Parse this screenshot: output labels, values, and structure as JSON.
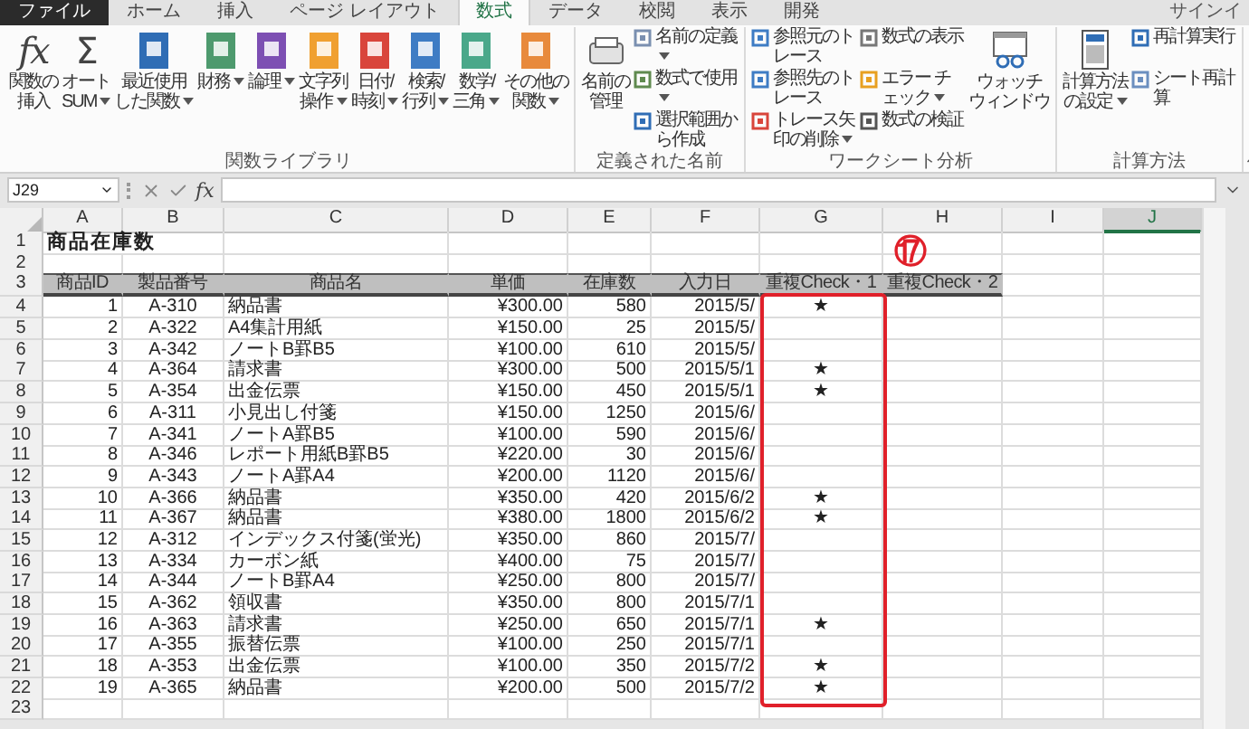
{
  "tabs": [
    {
      "label": "ファイル",
      "kind": "file",
      "selected": false
    },
    {
      "label": "ホーム",
      "kind": "tab",
      "selected": false
    },
    {
      "label": "挿入",
      "kind": "tab",
      "selected": false
    },
    {
      "label": "ページ レイアウト",
      "kind": "tab",
      "selected": false
    },
    {
      "label": "数式",
      "kind": "tab",
      "selected": true
    },
    {
      "label": "データ",
      "kind": "tab",
      "selected": false
    },
    {
      "label": "校閲",
      "kind": "tab",
      "selected": false
    },
    {
      "label": "表示",
      "kind": "tab",
      "selected": false
    },
    {
      "label": "開発",
      "kind": "tab",
      "selected": false
    }
  ],
  "account": "サインイ",
  "ribbon": {
    "groups": [
      {
        "title": "関数ライブラリ",
        "items": [
          {
            "kind": "large",
            "lines": [
              "関数の",
              "挿入"
            ],
            "glyph": "fx",
            "dropdown": false
          },
          {
            "kind": "large",
            "lines": [
              "オート",
              "SUM"
            ],
            "glyph": "Σ",
            "dropdown": true
          },
          {
            "kind": "large",
            "lines": [
              "最近使用",
              "した関数"
            ],
            "dropdown": true
          },
          {
            "kind": "large",
            "lines": [
              "財務"
            ],
            "dropdown": true
          },
          {
            "kind": "large",
            "lines": [
              "論理"
            ],
            "dropdown": true
          },
          {
            "kind": "large",
            "lines": [
              "文字列",
              "操作"
            ],
            "dropdown": true
          },
          {
            "kind": "large",
            "lines": [
              "日付/",
              "時刻"
            ],
            "dropdown": true
          },
          {
            "kind": "large",
            "lines": [
              "検索/",
              "行列"
            ],
            "dropdown": true
          },
          {
            "kind": "large",
            "lines": [
              "数学/",
              "三角"
            ],
            "dropdown": true
          },
          {
            "kind": "large",
            "lines": [
              "その他の",
              "関数"
            ],
            "dropdown": true
          }
        ]
      },
      {
        "title": "定義された名前",
        "items": [
          {
            "kind": "large",
            "lines": [
              "名前の",
              "管理"
            ],
            "dropdown": false
          },
          {
            "kind": "small",
            "label": "名前の定義",
            "dropdown": true
          },
          {
            "kind": "small",
            "label": "数式で使用",
            "dropdown": true
          },
          {
            "kind": "small",
            "label": "選択範囲から作成",
            "dropdown": false
          }
        ]
      },
      {
        "title": "ワークシート分析",
        "items": [
          {
            "kind": "small",
            "label": "参照元のトレース",
            "dropdown": false
          },
          {
            "kind": "small",
            "label": "参照先のトレース",
            "dropdown": false
          },
          {
            "kind": "small",
            "label": "トレース矢印の削除",
            "dropdown": true
          },
          {
            "kind": "small",
            "label": "数式の表示",
            "dropdown": false
          },
          {
            "kind": "small",
            "label": "エラー チェック",
            "dropdown": true
          },
          {
            "kind": "small",
            "label": "数式の検証",
            "dropdown": false
          },
          {
            "kind": "large",
            "lines": [
              "ウォッチ",
              "ウィンドウ"
            ],
            "dropdown": false
          }
        ]
      },
      {
        "title": "計算方法",
        "items": [
          {
            "kind": "large",
            "lines": [
              "計算方法",
              "の設定"
            ],
            "dropdown": true
          },
          {
            "kind": "small",
            "label": "再計算実行",
            "dropdown": false
          },
          {
            "kind": "small",
            "label": "シート再計算",
            "dropdown": false
          }
        ]
      }
    ]
  },
  "formula_bar": {
    "name_box": "J29",
    "function_button": "fx"
  },
  "sheet": {
    "columns": [
      {
        "label": "A",
        "selected": false
      },
      {
        "label": "B",
        "selected": false
      },
      {
        "label": "C",
        "selected": false
      },
      {
        "label": "D",
        "selected": false
      },
      {
        "label": "E",
        "selected": false
      },
      {
        "label": "F",
        "selected": false
      },
      {
        "label": "G",
        "selected": false
      },
      {
        "label": "H",
        "selected": false
      },
      {
        "label": "I",
        "selected": false
      },
      {
        "label": "J",
        "selected": true
      }
    ],
    "row_numbers": [
      "1",
      "2",
      "3",
      "4",
      "5",
      "6",
      "7",
      "8",
      "9",
      "10",
      "11",
      "12",
      "13",
      "14",
      "15",
      "16",
      "17",
      "18",
      "19",
      "20",
      "21",
      "22",
      "23"
    ],
    "title": "商品在庫数",
    "header": [
      "商品ID",
      "製品番号",
      "商品名",
      "単価",
      "在庫数",
      "入力日",
      "重複Check・1",
      "重複Check・2"
    ],
    "rows": [
      {
        "cells": [
          "1",
          "A-310",
          "納品書",
          "¥300.00",
          "580",
          "2015/5/"
        ],
        "check_1": "★"
      },
      {
        "cells": [
          "2",
          "A-322",
          "A4集計用紙",
          "¥150.00",
          "25",
          "2015/5/"
        ]
      },
      {
        "cells": [
          "3",
          "A-342",
          "ノートB罫B5",
          "¥100.00",
          "610",
          "2015/5/"
        ]
      },
      {
        "cells": [
          "4",
          "A-364",
          "請求書",
          "¥300.00",
          "500",
          "2015/5/1"
        ],
        "check_1": "★"
      },
      {
        "cells": [
          "5",
          "A-354",
          "出金伝票",
          "¥150.00",
          "450",
          "2015/5/1"
        ],
        "check_1": "★"
      },
      {
        "cells": [
          "6",
          "A-311",
          "小見出し付箋",
          "¥150.00",
          "1250",
          "2015/6/"
        ]
      },
      {
        "cells": [
          "7",
          "A-341",
          "ノートA罫B5",
          "¥100.00",
          "590",
          "2015/6/"
        ]
      },
      {
        "cells": [
          "8",
          "A-346",
          "レポート用紙B罫B5",
          "¥220.00",
          "30",
          "2015/6/"
        ]
      },
      {
        "cells": [
          "9",
          "A-343",
          "ノートA罫A4",
          "¥200.00",
          "1120",
          "2015/6/"
        ]
      },
      {
        "cells": [
          "10",
          "A-366",
          "納品書",
          "¥350.00",
          "420",
          "2015/6/2"
        ],
        "check_1": "★"
      },
      {
        "cells": [
          "11",
          "A-367",
          "納品書",
          "¥380.00",
          "1800",
          "2015/6/2"
        ],
        "check_1": "★"
      },
      {
        "cells": [
          "12",
          "A-312",
          "インデックス付箋(蛍光)",
          "¥350.00",
          "860",
          "2015/7/"
        ]
      },
      {
        "cells": [
          "13",
          "A-334",
          "カーボン紙",
          "¥400.00",
          "75",
          "2015/7/"
        ]
      },
      {
        "cells": [
          "14",
          "A-344",
          "ノートB罫A4",
          "¥250.00",
          "800",
          "2015/7/"
        ]
      },
      {
        "cells": [
          "15",
          "A-362",
          "領収書",
          "¥350.00",
          "800",
          "2015/7/1"
        ]
      },
      {
        "cells": [
          "16",
          "A-363",
          "請求書",
          "¥250.00",
          "650",
          "2015/7/1"
        ],
        "check_1": "★"
      },
      {
        "cells": [
          "17",
          "A-355",
          "振替伝票",
          "¥100.00",
          "250",
          "2015/7/1"
        ]
      },
      {
        "cells": [
          "18",
          "A-353",
          "出金伝票",
          "¥100.00",
          "350",
          "2015/7/2"
        ],
        "check_1": "★"
      },
      {
        "cells": [
          "19",
          "A-365",
          "納品書",
          "¥200.00",
          "500",
          "2015/7/2"
        ],
        "check_1": "★"
      }
    ]
  },
  "annotation": {
    "label": "⑰"
  }
}
